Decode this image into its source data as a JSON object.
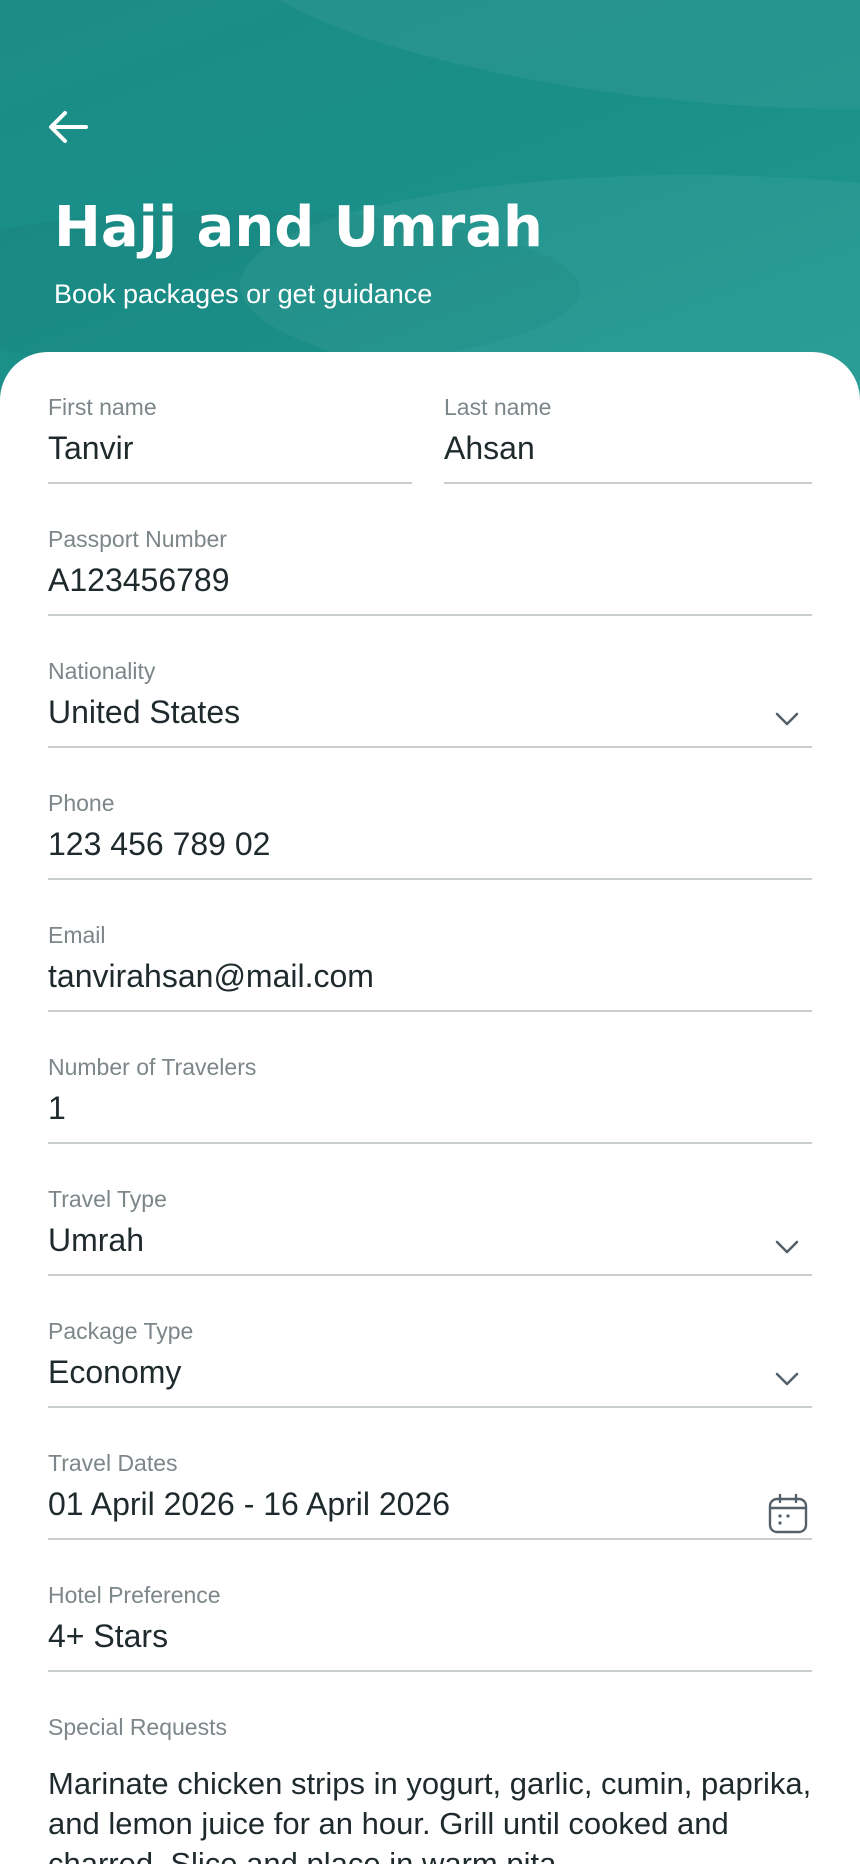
{
  "header": {
    "title": "Hajj and Umrah",
    "subtitle": "Book packages or get guidance",
    "back_icon": "arrow-left-icon",
    "colors": {
      "background": "#1a8f89",
      "text": "#ffffff"
    }
  },
  "form": {
    "first_name": {
      "label": "First name",
      "value": "Tanvir"
    },
    "last_name": {
      "label": "Last name",
      "value": "Ahsan"
    },
    "passport": {
      "label": "Passport Number",
      "value": "A123456789"
    },
    "nationality": {
      "label": "Nationality",
      "value": "United States",
      "icon": "chevron-down-icon"
    },
    "phone": {
      "label": "Phone",
      "value": "123 456 789 02"
    },
    "email": {
      "label": "Email",
      "value": "tanvirahsan@mail.com"
    },
    "travelers": {
      "label": "Number of Travelers",
      "value": "1"
    },
    "travel_type": {
      "label": "Travel Type",
      "value": "Umrah",
      "icon": "chevron-down-icon"
    },
    "package_type": {
      "label": "Package Type",
      "value": "Economy",
      "icon": "chevron-down-icon"
    },
    "travel_dates": {
      "label": "Travel Dates",
      "value": "01 April 2026 - 16 April 2026",
      "icon": "calendar-icon"
    },
    "hotel": {
      "label": "Hotel Preference",
      "value": "4+ Stars"
    },
    "special_requests": {
      "label": "Special Requests",
      "value": "Marinate chicken strips in yogurt, garlic, cumin, paprika, and lemon juice for an hour. Grill until cooked and charred. Slice and place in warm pita"
    }
  }
}
